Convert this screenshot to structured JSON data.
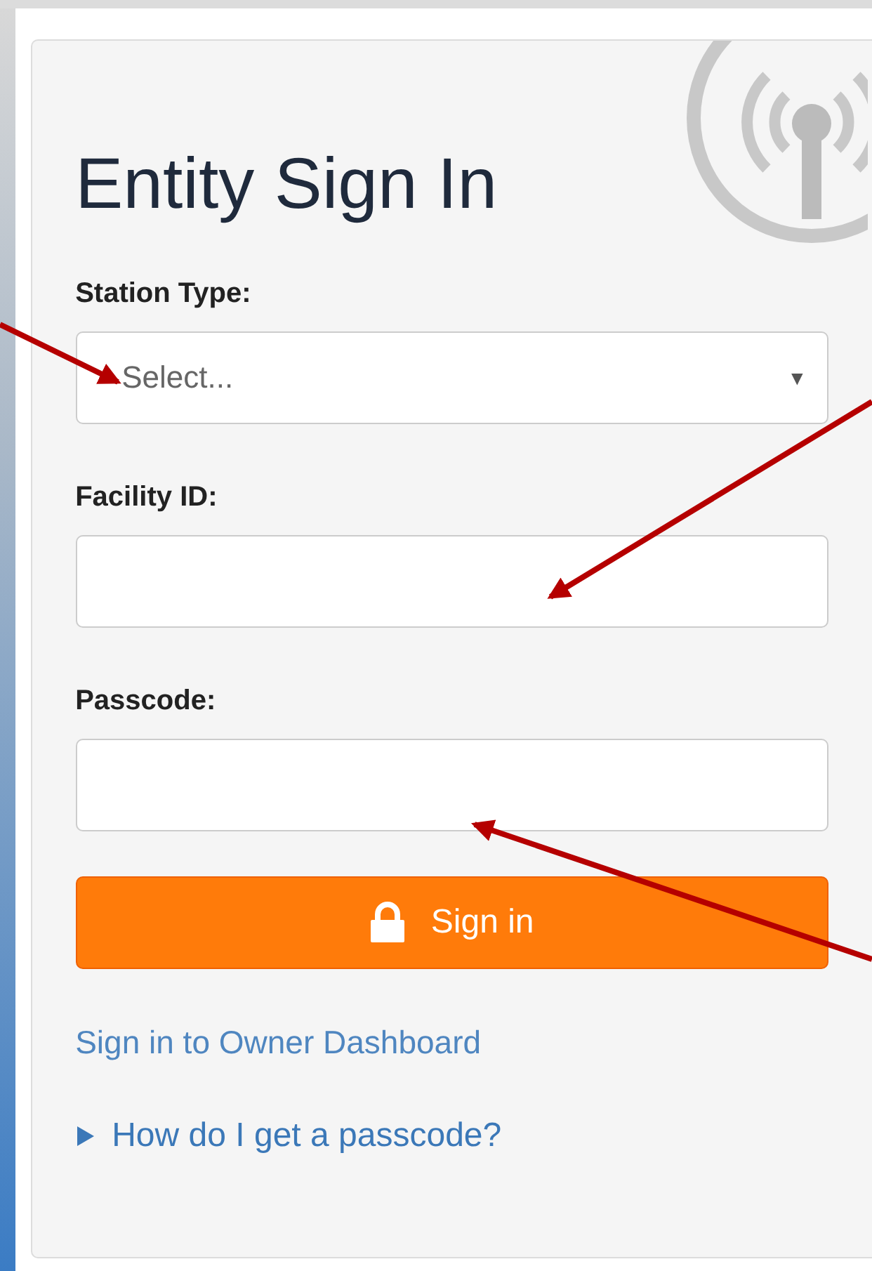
{
  "title": "Entity Sign In",
  "fields": [
    {
      "label": "Station Type:",
      "kind": "select",
      "placeholder": "Select...",
      "caret": "▼"
    },
    {
      "label": "Facility ID:",
      "kind": "text"
    },
    {
      "label": "Passcode:",
      "kind": "password"
    }
  ],
  "submit": {
    "label": "Sign in"
  },
  "owner_link": "Sign in to Owner Dashboard",
  "help": {
    "label": "How do I get a passcode?",
    "expanded": false
  }
}
